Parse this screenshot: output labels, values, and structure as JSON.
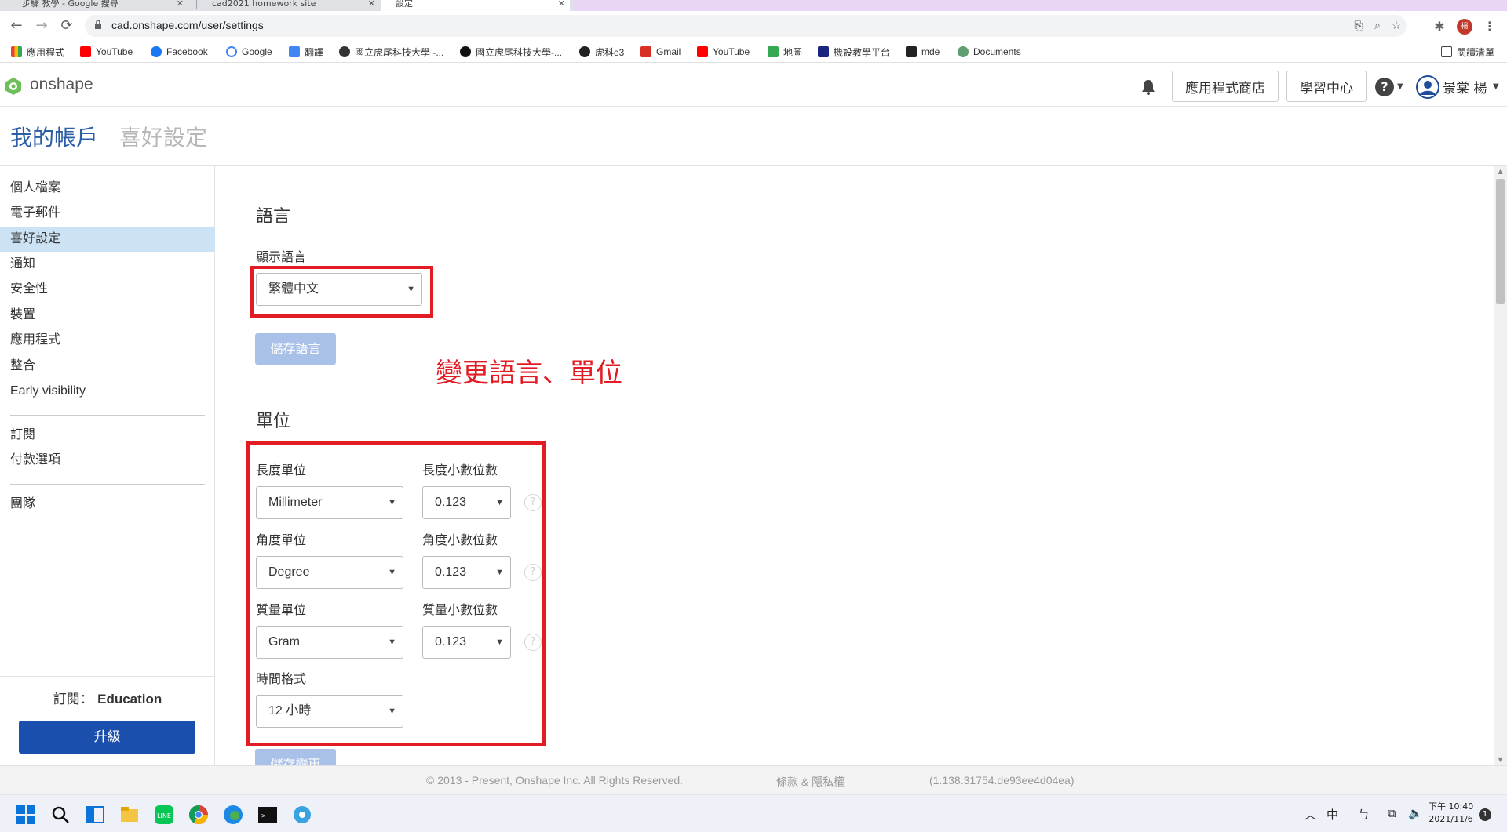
{
  "browser": {
    "tabs": [
      {
        "title": "步驟 教學 - Google 搜尋"
      },
      {
        "title": "cad2021 homework site"
      },
      {
        "title": "設定"
      }
    ],
    "url": "cad.onshape.com/user/settings",
    "bookmarks": [
      {
        "label": "應用程式",
        "icon": "apps-grid-icon",
        "color": "#4285f4"
      },
      {
        "label": "YouTube",
        "icon": "youtube-icon",
        "color": "#ff0000"
      },
      {
        "label": "Facebook",
        "icon": "facebook-icon",
        "color": "#1877f2"
      },
      {
        "label": "Google",
        "icon": "google-icon",
        "color": "#4285f4"
      },
      {
        "label": "翻譯",
        "icon": "translate-icon",
        "color": "#4285f4"
      },
      {
        "label": "國立虎尾科技大學 -...",
        "icon": "nfu-icon",
        "color": "#333333"
      },
      {
        "label": "國立虎尾科技大學-...",
        "icon": "nfu2-icon",
        "color": "#111111"
      },
      {
        "label": "虎科e3",
        "icon": "e3-icon",
        "color": "#222222"
      },
      {
        "label": "Gmail",
        "icon": "gmail-icon",
        "color": "#d93025"
      },
      {
        "label": "YouTube",
        "icon": "youtube-icon",
        "color": "#ff0000"
      },
      {
        "label": "地圖",
        "icon": "maps-icon",
        "color": "#34a853"
      },
      {
        "label": "機設教學平台",
        "icon": "platform-icon",
        "color": "#1a237e"
      },
      {
        "label": "mde",
        "icon": "mde-icon",
        "color": "#222222"
      },
      {
        "label": "Documents",
        "icon": "documents-icon",
        "color": "#5f9e6e"
      }
    ],
    "reading_list": "閱讀清單"
  },
  "header": {
    "logo": "onshape",
    "app_store": "應用程式商店",
    "learning_center": "學習中心",
    "user_name": "景棠 楊"
  },
  "page": {
    "title": "我的帳戶",
    "subtitle": "喜好設定"
  },
  "sidebar": {
    "items": [
      {
        "label": "個人檔案"
      },
      {
        "label": "電子郵件"
      },
      {
        "label": "喜好設定"
      },
      {
        "label": "通知"
      },
      {
        "label": "安全性"
      },
      {
        "label": "裝置"
      },
      {
        "label": "應用程式"
      },
      {
        "label": "整合"
      },
      {
        "label": "Early visibility"
      },
      {
        "label": "訂閱"
      },
      {
        "label": "付款選項"
      },
      {
        "label": "團隊"
      }
    ],
    "subscription_label": "訂閱：",
    "subscription_value": "Education",
    "upgrade": "升級"
  },
  "language": {
    "section_title": "語言",
    "display_label": "顯示語言",
    "display_value": "繁體中文",
    "save": "儲存語言"
  },
  "annotation": "變更語言、單位",
  "units": {
    "section_title": "單位",
    "length_label": "長度單位",
    "length_value": "Millimeter",
    "length_dec_label": "長度小數位數",
    "length_dec_value": "0.123",
    "angle_label": "角度單位",
    "angle_value": "Degree",
    "angle_dec_label": "角度小數位數",
    "angle_dec_value": "0.123",
    "mass_label": "質量單位",
    "mass_value": "Gram",
    "mass_dec_label": "質量小數位數",
    "mass_dec_value": "0.123",
    "time_label": "時間格式",
    "time_value": "12 小時",
    "save": "儲存變更"
  },
  "footer": {
    "copyright": "© 2013 - Present, Onshape Inc. All Rights Reserved.",
    "terms": "條款 & 隱私權",
    "version": "(1.138.31754.de93ee4d04ea)"
  },
  "taskbar": {
    "ime": "中",
    "time": "下午 10:40",
    "date": "2021/11/6",
    "notifications": "1"
  },
  "colors": {
    "accent": "#2c5ea5",
    "upgrade": "#1a4fad",
    "annotation_red": "#e11c24",
    "active_nav": "#cce3f6"
  }
}
